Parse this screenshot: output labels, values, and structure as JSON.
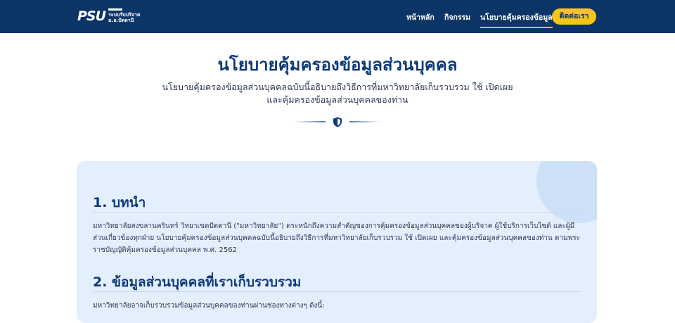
{
  "header": {
    "logo_mark": "PSU",
    "logo_line1": "ระบบรับบริจาค",
    "logo_line2": "ม.อ.ปัตตานี",
    "nav": {
      "home": "หน้าหลัก",
      "activities": "กิจกรรม",
      "privacy": "นโยบายคุ้มครองข้อมูล",
      "contact": "ติดต่อเรา"
    },
    "accent_color": "#f5c518",
    "background_color": "#0b3566"
  },
  "hero": {
    "title": "นโยบายคุ้มครองข้อมูลส่วนบุคคล",
    "subtitle_line1": "นโยบายคุ้มครองข้อมูลส่วนบุคคลฉบับนี้อธิบายถึงวิธีการที่มหาวิทยาลัยเก็บรวบรวม ใช้ เปิดเผย",
    "subtitle_line2": "และคุ้มครองข้อมูลส่วนบุคคลของท่าน",
    "divider_icon": "shield-icon"
  },
  "sections": [
    {
      "title": "1. บทนำ",
      "body": "มหาวิทยาลัยสงขลานครินทร์ วิทยาเขตปัตตานี (\"มหาวิทยาลัย\") ตระหนักถึงความสำคัญของการคุ้มครองข้อมูลส่วนบุคคลของผู้บริจาค ผู้ใช้บริการเว็บไซต์ และผู้มีส่วนเกี่ยวข้องทุกฝ่าย นโยบายคุ้มครองข้อมูลส่วนบุคคลฉบับนี้อธิบายถึงวิธีการที่มหาวิทยาลัยเก็บรวบรวม ใช้ เปิดเผย และคุ้มครองข้อมูลส่วนบุคคลของท่าน ตามพระราชบัญญัติคุ้มครองข้อมูลส่วนบุคคล พ.ศ. 2562"
    },
    {
      "title": "2. ข้อมูลส่วนบุคคลที่เราเก็บรวบรวม",
      "body": "มหาวิทยาลัยอาจเก็บรวบรวมข้อมูลส่วนบุคคลของท่านผ่านช่องทางต่างๆ ดังนี้:"
    }
  ]
}
